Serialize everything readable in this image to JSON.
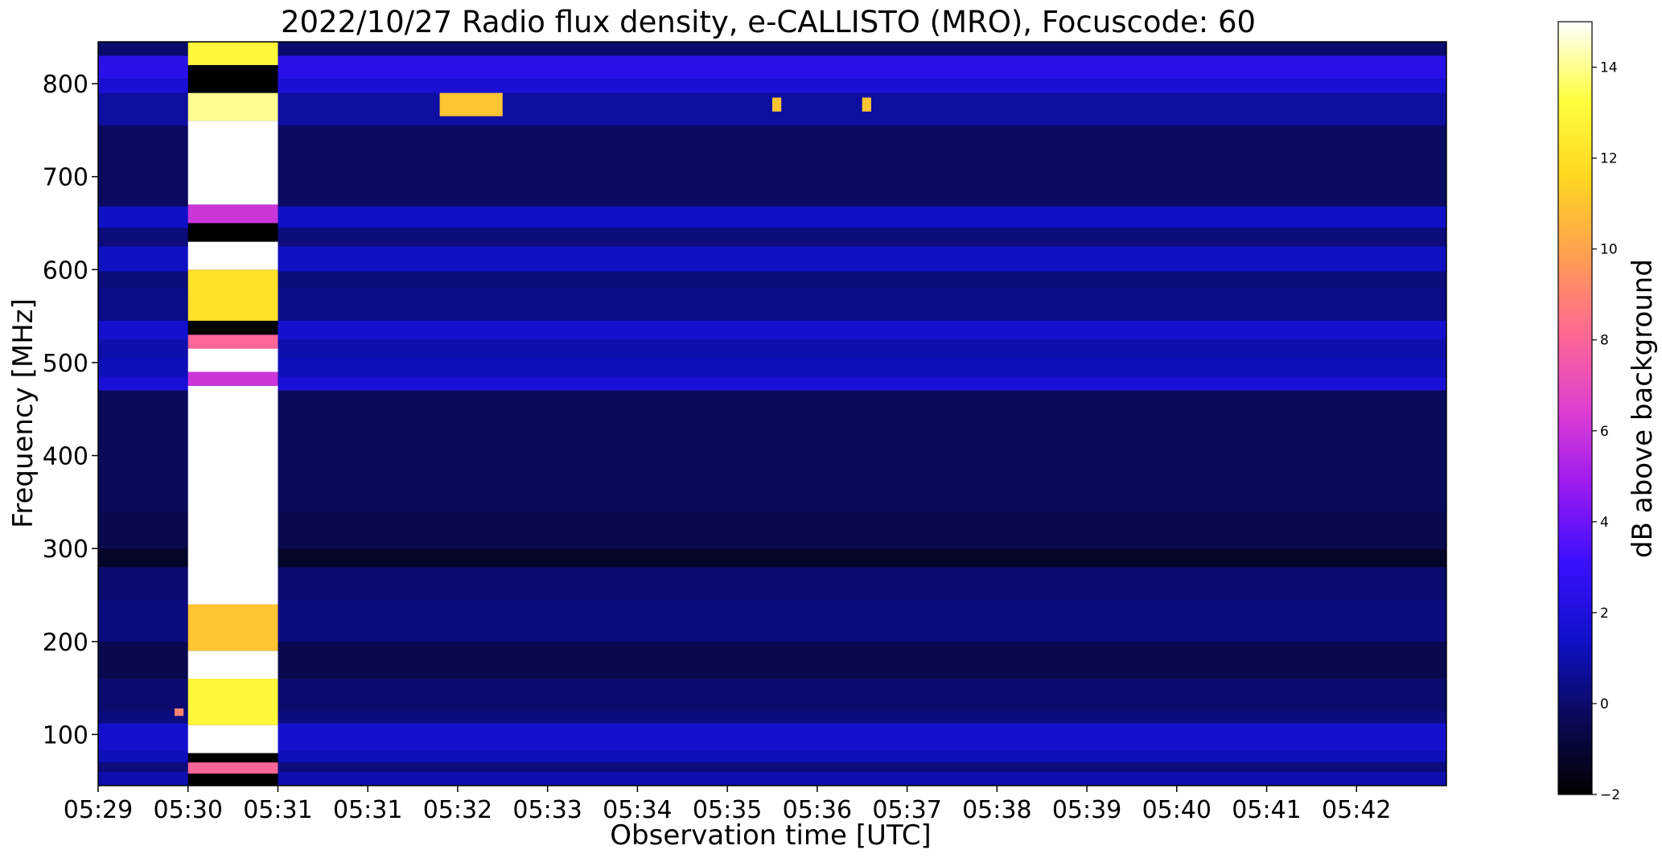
{
  "chart_data": {
    "type": "heatmap",
    "title": "2022/10/27  Radio flux density, e-CALLISTO (MRO), Focuscode: 60",
    "xlabel": "Observation time [UTC]",
    "ylabel": "Frequency [MHz]",
    "x_tick_labels": [
      "05:29",
      "05:30",
      "05:31",
      "05:31",
      "05:32",
      "05:33",
      "05:34",
      "05:35",
      "05:36",
      "05:37",
      "05:38",
      "05:39",
      "05:40",
      "05:41",
      "05:42"
    ],
    "y_ticks": [
      100,
      200,
      300,
      400,
      500,
      600,
      700,
      800
    ],
    "ylim": [
      45,
      845
    ],
    "colorbar": {
      "label": "dB above background",
      "ticks": [
        -2,
        0,
        2,
        4,
        6,
        8,
        10,
        12,
        14
      ],
      "range": [
        -2,
        15
      ],
      "colormap": "gnuplot2",
      "stops": [
        "#000000",
        "#0a0a5a",
        "#1010c8",
        "#3a10ff",
        "#9a1af0",
        "#e040d0",
        "#ff6a90",
        "#ffa050",
        "#ffd820",
        "#ffff40",
        "#ffffff"
      ]
    },
    "regions": {
      "saturated_block_x": [
        1.0,
        2.0
      ],
      "background_level_db": 0,
      "band_rows": [
        {
          "freq": [
            45,
            60
          ],
          "db": 1.0
        },
        {
          "freq": [
            60,
            70
          ],
          "db": 0.2
        },
        {
          "freq": [
            70,
            82
          ],
          "db": 1.2
        },
        {
          "freq": [
            82,
            112
          ],
          "db": 1.6
        },
        {
          "freq": [
            112,
            125
          ],
          "db": 0.3
        },
        {
          "freq": [
            125,
            160
          ],
          "db": 0.0
        },
        {
          "freq": [
            160,
            200
          ],
          "db": -0.5
        },
        {
          "freq": [
            200,
            245
          ],
          "db": 0.3
        },
        {
          "freq": [
            245,
            280
          ],
          "db": 0.0
        },
        {
          "freq": [
            280,
            300
          ],
          "db": -1.2
        },
        {
          "freq": [
            300,
            340
          ],
          "db": -0.5
        },
        {
          "freq": [
            340,
            470
          ],
          "db": -0.3
        },
        {
          "freq": [
            470,
            485
          ],
          "db": 1.8
        },
        {
          "freq": [
            485,
            505
          ],
          "db": 1.2
        },
        {
          "freq": [
            505,
            525
          ],
          "db": 1.0
        },
        {
          "freq": [
            525,
            545
          ],
          "db": 1.6
        },
        {
          "freq": [
            545,
            580
          ],
          "db": 0.4
        },
        {
          "freq": [
            580,
            598
          ],
          "db": 0.2
        },
        {
          "freq": [
            598,
            625
          ],
          "db": 1.3
        },
        {
          "freq": [
            625,
            645
          ],
          "db": 0.2
        },
        {
          "freq": [
            645,
            668
          ],
          "db": 1.4
        },
        {
          "freq": [
            668,
            755
          ],
          "db": -0.2
        },
        {
          "freq": [
            755,
            790
          ],
          "db": 0.8
        },
        {
          "freq": [
            790,
            805
          ],
          "db": 1.8
        },
        {
          "freq": [
            805,
            830
          ],
          "db": 2.4
        },
        {
          "freq": [
            830,
            845
          ],
          "db": 0.0
        }
      ],
      "saturated_rows": [
        {
          "freq": [
            45,
            58
          ],
          "db": -2
        },
        {
          "freq": [
            58,
            70
          ],
          "db": 8
        },
        {
          "freq": [
            70,
            80
          ],
          "db": -2
        },
        {
          "freq": [
            80,
            110
          ],
          "db": 15
        },
        {
          "freq": [
            110,
            160
          ],
          "db": 13
        },
        {
          "freq": [
            160,
            190
          ],
          "db": 15
        },
        {
          "freq": [
            190,
            240
          ],
          "db": 11
        },
        {
          "freq": [
            240,
            475
          ],
          "db": 15
        },
        {
          "freq": [
            475,
            490
          ],
          "db": 6
        },
        {
          "freq": [
            490,
            515
          ],
          "db": 15
        },
        {
          "freq": [
            515,
            530
          ],
          "db": 8
        },
        {
          "freq": [
            530,
            545
          ],
          "db": -2
        },
        {
          "freq": [
            545,
            600
          ],
          "db": 12
        },
        {
          "freq": [
            600,
            630
          ],
          "db": 15
        },
        {
          "freq": [
            630,
            650
          ],
          "db": -2
        },
        {
          "freq": [
            650,
            670
          ],
          "db": 6
        },
        {
          "freq": [
            670,
            760
          ],
          "db": 15
        },
        {
          "freq": [
            760,
            790
          ],
          "db": 14
        },
        {
          "freq": [
            790,
            820
          ],
          "db": -2
        },
        {
          "freq": [
            820,
            845
          ],
          "db": 13
        }
      ],
      "bursts": [
        {
          "x": [
            3.8,
            4.5
          ],
          "freq": [
            765,
            790
          ],
          "db": 11
        },
        {
          "x": [
            7.5,
            7.6
          ],
          "freq": [
            770,
            785
          ],
          "db": 11
        },
        {
          "x": [
            8.5,
            8.6
          ],
          "freq": [
            770,
            785
          ],
          "db": 11
        },
        {
          "x": [
            0.85,
            0.95
          ],
          "freq": [
            120,
            128
          ],
          "db": 9
        }
      ]
    }
  }
}
